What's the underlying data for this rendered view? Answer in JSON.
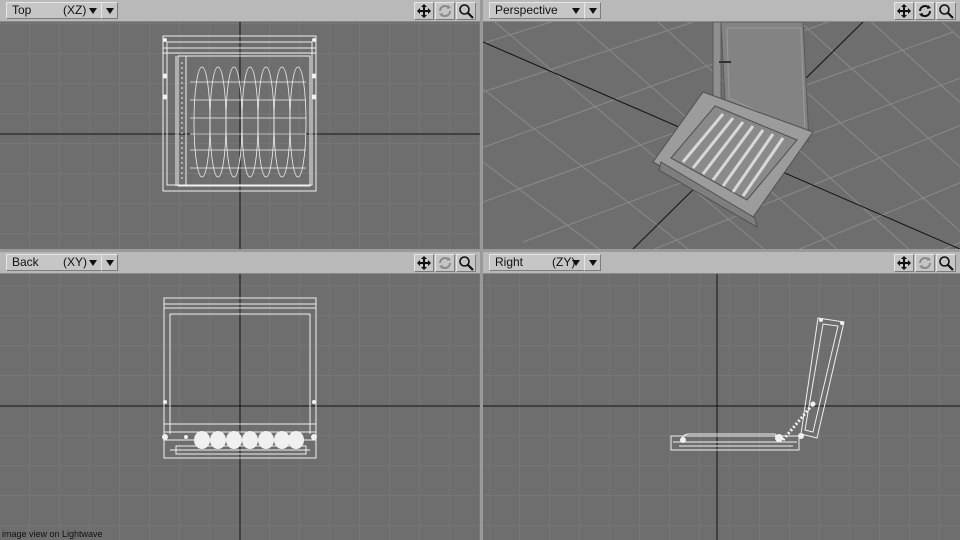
{
  "viewports": {
    "top": {
      "name": "Top",
      "axis": "(XZ)"
    },
    "perspective": {
      "name": "Perspective",
      "axis": ""
    },
    "back": {
      "name": "Back",
      "axis": "(XY)"
    },
    "right": {
      "name": "Right",
      "axis": "(ZY)"
    }
  },
  "tools": {
    "move": "move-icon",
    "rotate": "rotate-icon",
    "zoom": "zoom-icon"
  },
  "caption": "image view on Lightwave",
  "colors": {
    "background": "#6e6e6e",
    "grid": "#7d7d7d",
    "axis": "#111111",
    "wire": "#f0f0f0",
    "toolbar": "#b9b9b9"
  }
}
